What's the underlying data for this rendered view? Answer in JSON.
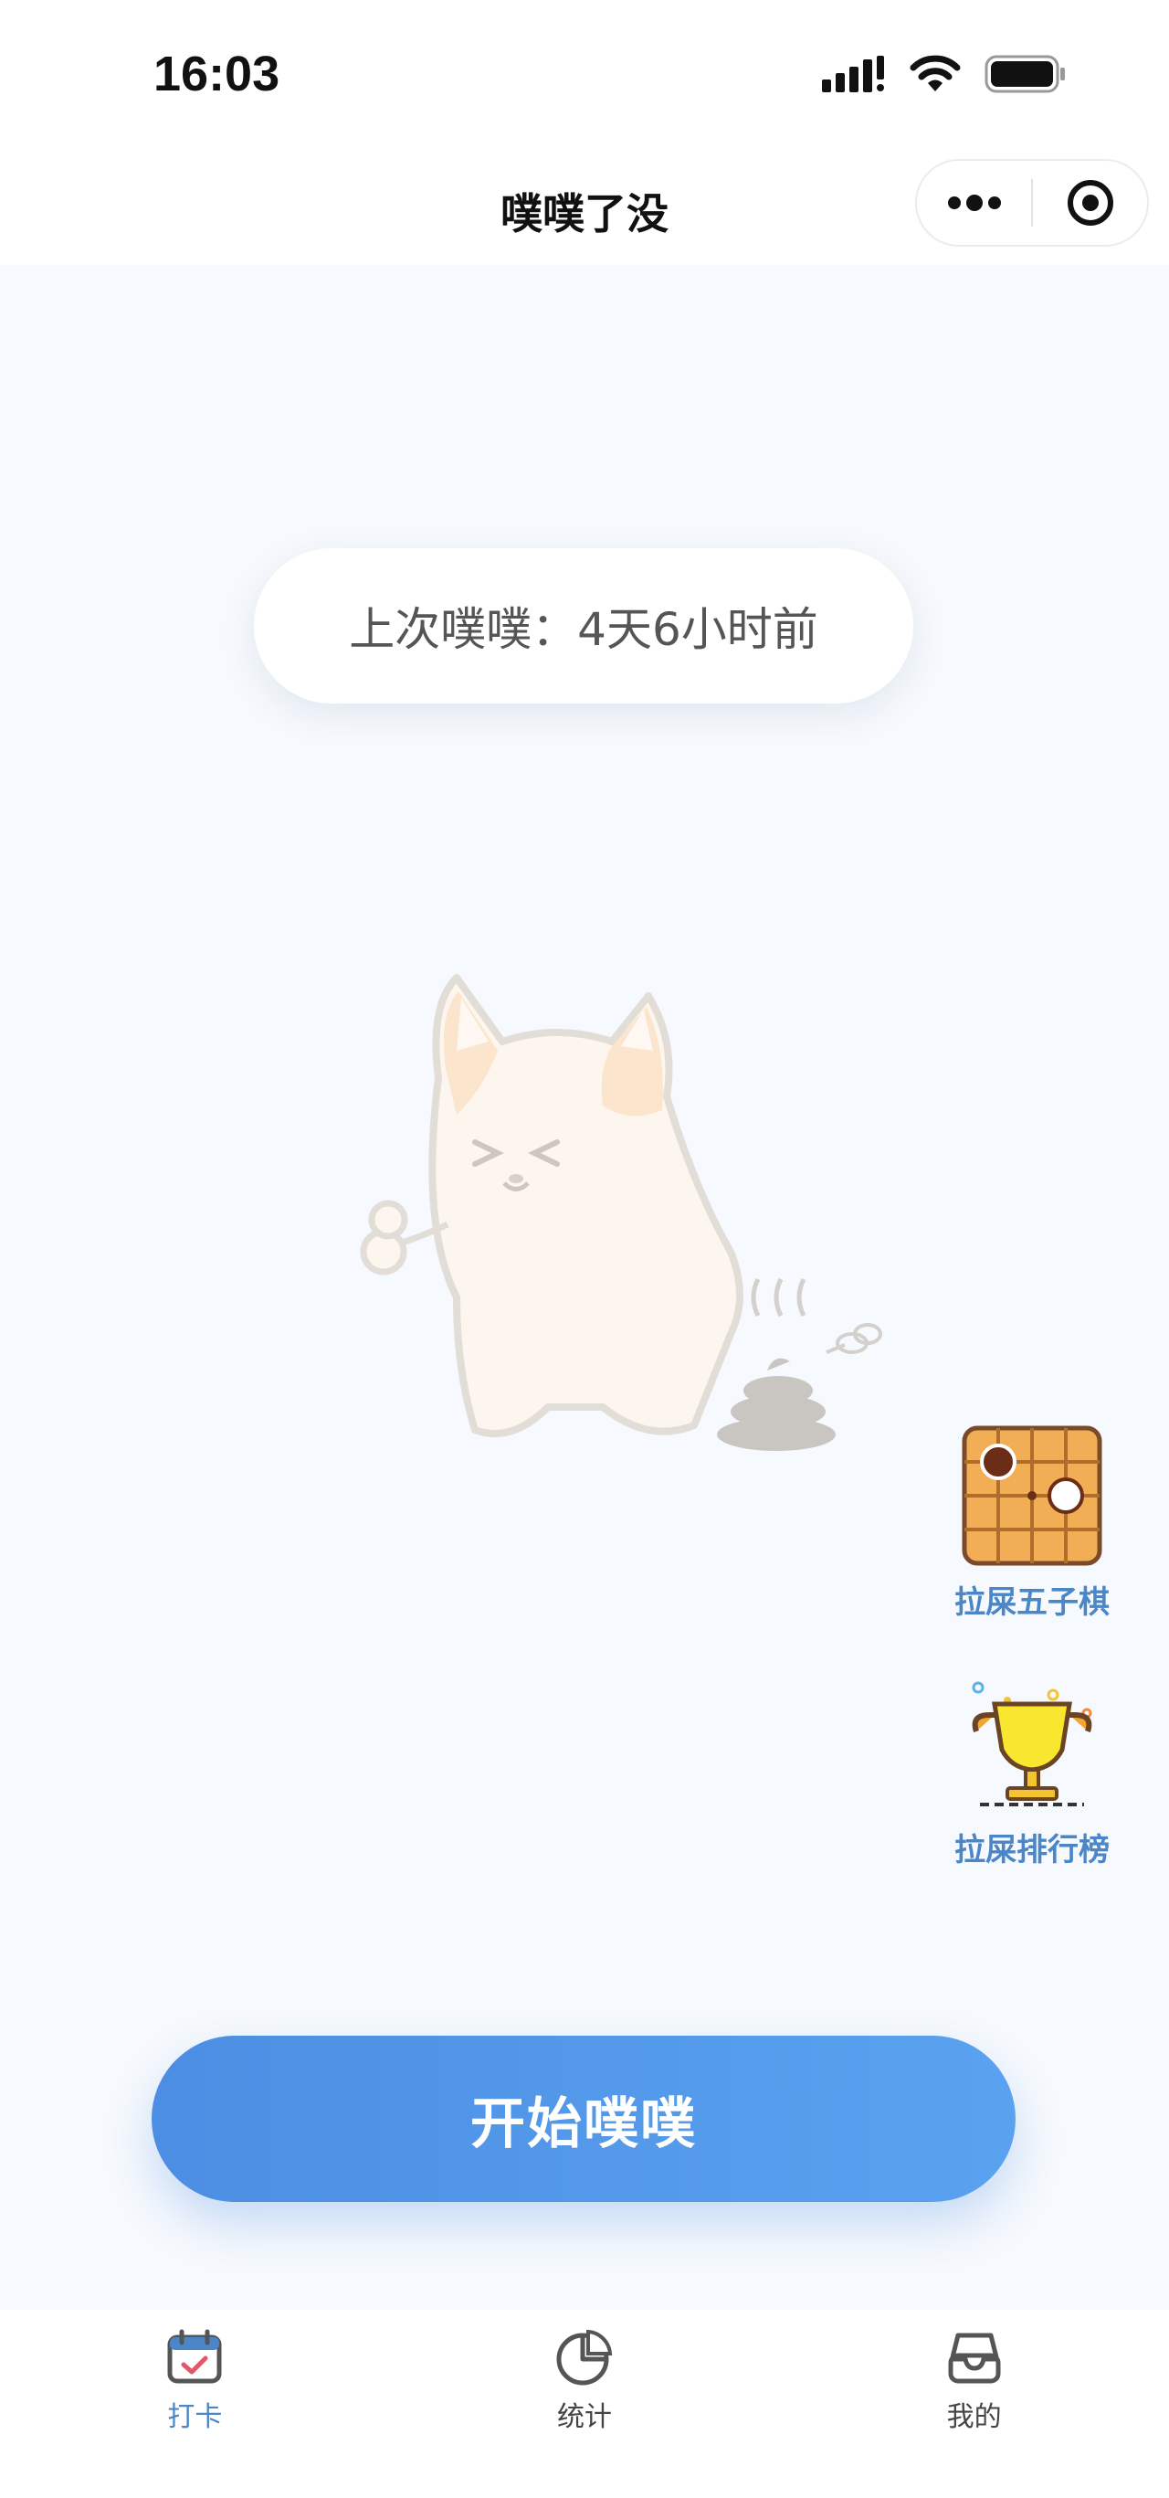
{
  "status_bar": {
    "time": "16:03"
  },
  "nav": {
    "title": "噗噗了没"
  },
  "last_poop": {
    "text": "上次噗噗：4天6小时前"
  },
  "side_actions": [
    {
      "label": "拉屎五子棋",
      "icon": "gomoku-board-icon"
    },
    {
      "label": "拉屎排行榜",
      "icon": "trophy-icon"
    }
  ],
  "main_action": {
    "label": "开始噗噗"
  },
  "tabs": [
    {
      "label": "打卡",
      "icon": "calendar-check-icon",
      "active": true
    },
    {
      "label": "统计",
      "icon": "pie-chart-icon",
      "active": false
    },
    {
      "label": "我的",
      "icon": "inbox-icon",
      "active": false
    }
  ],
  "colors": {
    "accent": "#4a86c8",
    "button_start": "#4c8ee3",
    "button_end": "#5aa2f0",
    "background": "#f6f9fd"
  }
}
